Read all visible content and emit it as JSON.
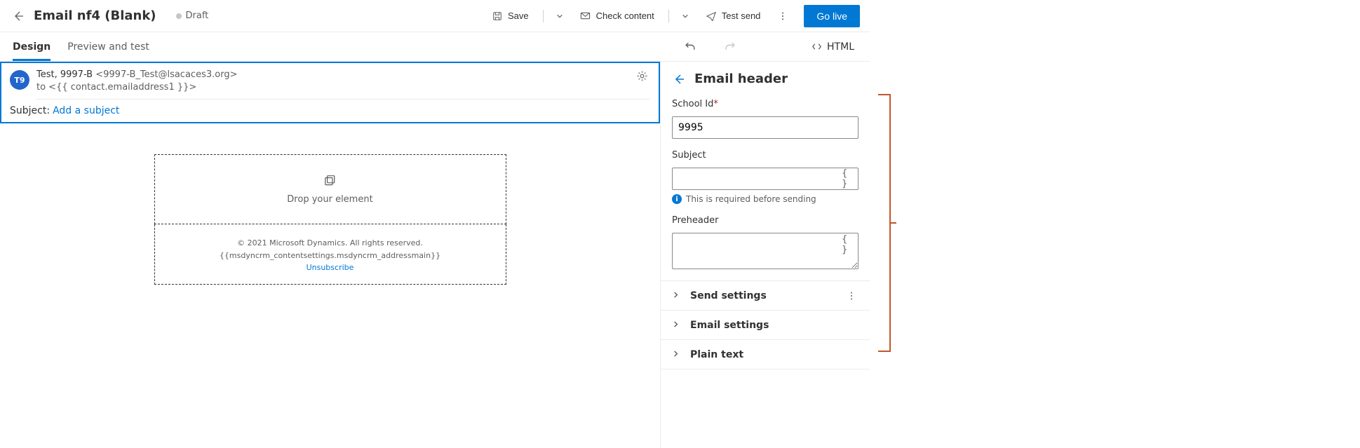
{
  "header": {
    "title": "Email nf4 (Blank)",
    "status": "Draft",
    "save": "Save",
    "check": "Check content",
    "test": "Test send",
    "golive": "Go live"
  },
  "tabs": {
    "design": "Design",
    "preview": "Preview and test",
    "html": "HTML"
  },
  "email": {
    "avatar": "T9",
    "from_name": "Test, 9997-B ",
    "from_addr": "<9997-B_Test@lsacaces3.org>",
    "to_line": "to  <{{ contact.emailaddress1 }}>",
    "subject_label": "Subject:",
    "subject_link": "Add a subject"
  },
  "canvas": {
    "drop": "Drop your element",
    "copyright": "© 2021 Microsoft Dynamics. All rights reserved.",
    "address": "{{msdyncrm_contentsettings.msdyncrm_addressmain}}",
    "unsubscribe": "Unsubscribe"
  },
  "panel": {
    "title": "Email header",
    "school_label": "School Id",
    "school_value": "9995",
    "subject_label": "Subject",
    "subject_value": "",
    "subject_help": "This is required before sending",
    "preheader_label": "Preheader",
    "preheader_value": "",
    "acc": {
      "send": "Send settings",
      "email": "Email settings",
      "plain": "Plain text"
    },
    "token": "{ }"
  }
}
